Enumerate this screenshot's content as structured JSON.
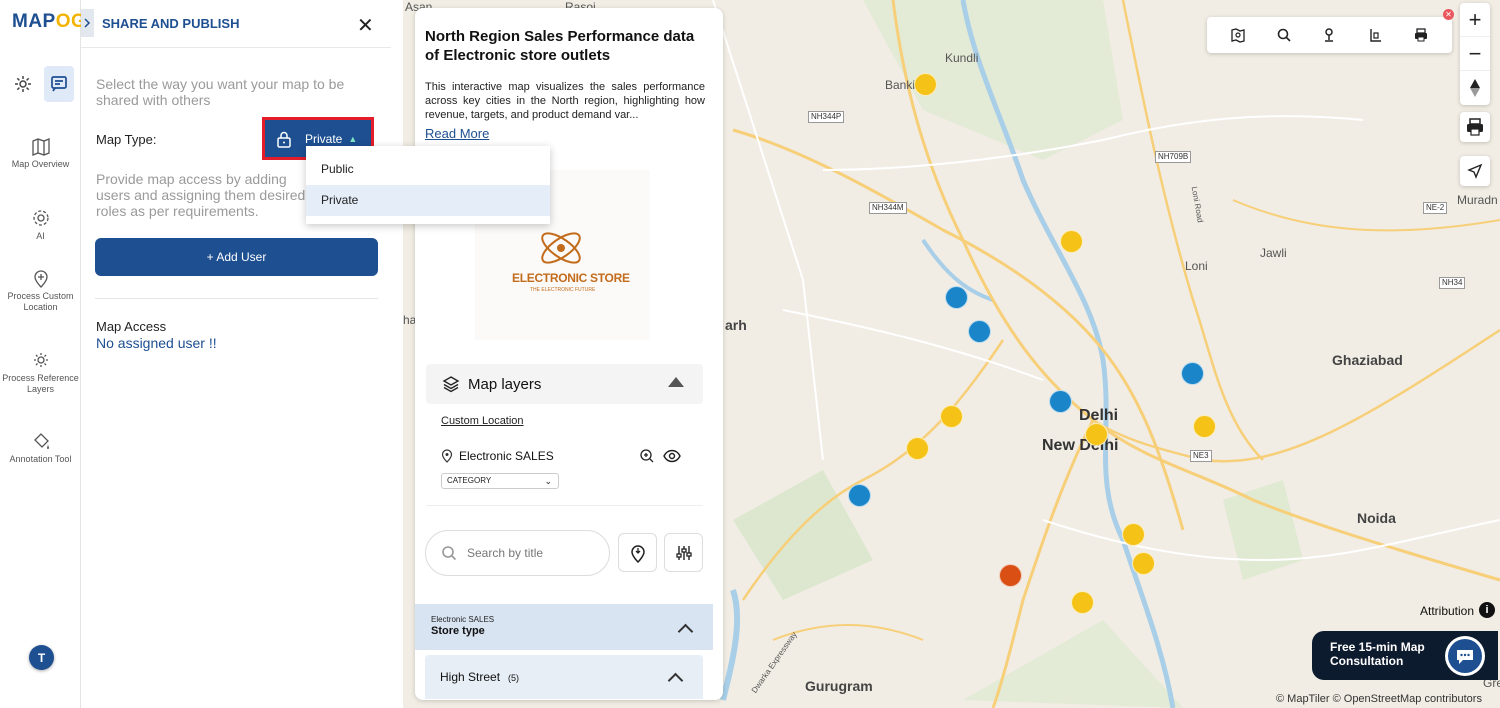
{
  "brand": {
    "logo_a": "MAP",
    "logo_b": "OG"
  },
  "rail": {
    "items": [
      {
        "label": "Map Overview"
      },
      {
        "label": "AI"
      },
      {
        "label": "Process Custom Location"
      },
      {
        "label": "Process Reference Layers"
      },
      {
        "label": "Annotation Tool"
      }
    ],
    "avatar": "T"
  },
  "share_panel": {
    "title": "SHARE AND PUBLISH",
    "intro": "Select the way you want your map to be shared with others",
    "map_type_label": "Map Type:",
    "map_type_value": "Private",
    "map_type_options": [
      "Public",
      "Private"
    ],
    "access_hint": "Provide map access by adding users and assigning them desired roles as per requirements.",
    "add_user_label": "+ Add User",
    "map_access_label": "Map Access",
    "map_access_value": "No assigned user !!"
  },
  "card": {
    "title": "North Region Sales Performance data of Electronic store outlets",
    "description": "This interactive map visualizes the sales performance across key cities in the North region, highlighting how revenue, targets, and product demand var...",
    "read_more": "Read More",
    "logo_text": "ELECTRONIC STORE",
    "logo_sub": "THE ELECTRONIC FUTURE",
    "layers_title": "Map layers",
    "custom_location": "Custom Location",
    "layer_name": "Electronic SALES",
    "category_select": "CATEGORY",
    "search_placeholder": "Search by title",
    "group_small": "Electronic SALES",
    "group_title": "Store type",
    "subgroup_label": "High Street",
    "subgroup_count": "(5)"
  },
  "map": {
    "places": [
      "Asan",
      "Rasoi",
      "Kundli",
      "Banki",
      "Loni",
      "Jawli",
      "Muradn",
      "Ghaziabad",
      "Delhi",
      "New Delhi",
      "Noida",
      "Gurugram",
      "Greate",
      "arh",
      "ha"
    ],
    "roads": [
      "NH344P",
      "NH709B",
      "NH344M",
      "NE-2",
      "NH34",
      "NE3",
      "Loni Road",
      "Dwarka Expressway"
    ],
    "marker_colors": {
      "yellow": "#f5c217",
      "blue": "#1a85c8",
      "orange": "#d94f14"
    },
    "attribution": "Attribution",
    "consult": "Free 15-min Map Consultation",
    "copyright": "© MapTiler © OpenStreetMap contributors"
  }
}
